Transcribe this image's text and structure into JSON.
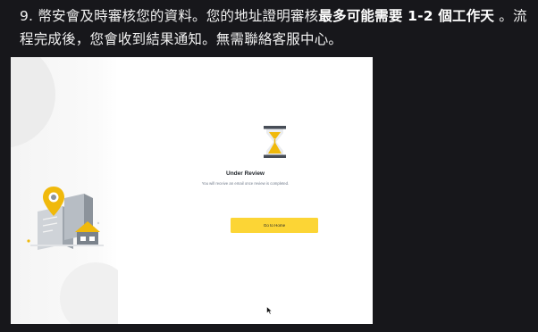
{
  "instruction": {
    "text_before": "9. 幣安會及時審核您的資料。您的地址證明審核",
    "bold_text": "最多可能需要 1-2 個工作天",
    "text_after": " 。流程完成後，您會收到結果通知。無需聯絡客服中心。"
  },
  "review_panel": {
    "title": "Under Review",
    "description": "You will receive an email once review is completed.",
    "home_button_label": "Go to Home"
  },
  "colors": {
    "page_background": "#17171b",
    "accent_yellow": "#fcd535",
    "title_text": "#1e2329",
    "muted_text": "#707a8a"
  },
  "icons": {
    "hourglass": "hourglass-icon",
    "illustration": "location-building-illustration",
    "cursor": "mouse-cursor-icon"
  }
}
